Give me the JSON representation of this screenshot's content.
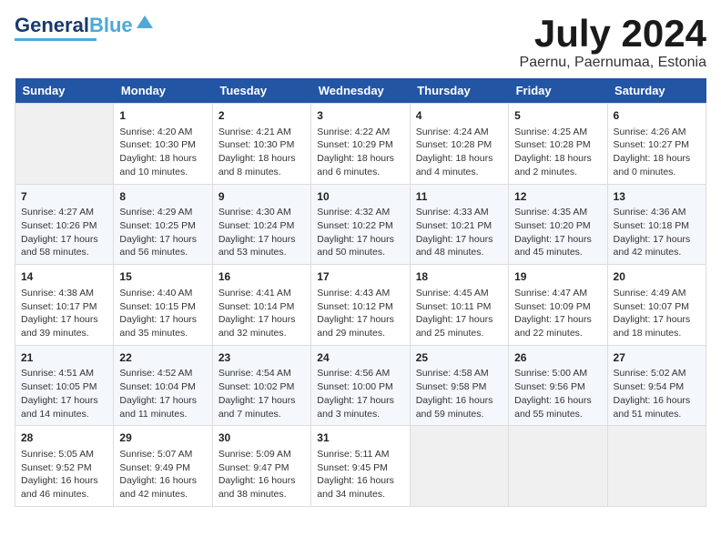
{
  "header": {
    "logo_general": "General",
    "logo_blue": "Blue",
    "month_title": "July 2024",
    "location": "Paernu, Paernumaa, Estonia"
  },
  "days_of_week": [
    "Sunday",
    "Monday",
    "Tuesday",
    "Wednesday",
    "Thursday",
    "Friday",
    "Saturday"
  ],
  "weeks": [
    [
      {
        "day": "",
        "info": ""
      },
      {
        "day": "1",
        "info": "Sunrise: 4:20 AM\nSunset: 10:30 PM\nDaylight: 18 hours\nand 10 minutes."
      },
      {
        "day": "2",
        "info": "Sunrise: 4:21 AM\nSunset: 10:30 PM\nDaylight: 18 hours\nand 8 minutes."
      },
      {
        "day": "3",
        "info": "Sunrise: 4:22 AM\nSunset: 10:29 PM\nDaylight: 18 hours\nand 6 minutes."
      },
      {
        "day": "4",
        "info": "Sunrise: 4:24 AM\nSunset: 10:28 PM\nDaylight: 18 hours\nand 4 minutes."
      },
      {
        "day": "5",
        "info": "Sunrise: 4:25 AM\nSunset: 10:28 PM\nDaylight: 18 hours\nand 2 minutes."
      },
      {
        "day": "6",
        "info": "Sunrise: 4:26 AM\nSunset: 10:27 PM\nDaylight: 18 hours\nand 0 minutes."
      }
    ],
    [
      {
        "day": "7",
        "info": "Sunrise: 4:27 AM\nSunset: 10:26 PM\nDaylight: 17 hours\nand 58 minutes."
      },
      {
        "day": "8",
        "info": "Sunrise: 4:29 AM\nSunset: 10:25 PM\nDaylight: 17 hours\nand 56 minutes."
      },
      {
        "day": "9",
        "info": "Sunrise: 4:30 AM\nSunset: 10:24 PM\nDaylight: 17 hours\nand 53 minutes."
      },
      {
        "day": "10",
        "info": "Sunrise: 4:32 AM\nSunset: 10:22 PM\nDaylight: 17 hours\nand 50 minutes."
      },
      {
        "day": "11",
        "info": "Sunrise: 4:33 AM\nSunset: 10:21 PM\nDaylight: 17 hours\nand 48 minutes."
      },
      {
        "day": "12",
        "info": "Sunrise: 4:35 AM\nSunset: 10:20 PM\nDaylight: 17 hours\nand 45 minutes."
      },
      {
        "day": "13",
        "info": "Sunrise: 4:36 AM\nSunset: 10:18 PM\nDaylight: 17 hours\nand 42 minutes."
      }
    ],
    [
      {
        "day": "14",
        "info": "Sunrise: 4:38 AM\nSunset: 10:17 PM\nDaylight: 17 hours\nand 39 minutes."
      },
      {
        "day": "15",
        "info": "Sunrise: 4:40 AM\nSunset: 10:15 PM\nDaylight: 17 hours\nand 35 minutes."
      },
      {
        "day": "16",
        "info": "Sunrise: 4:41 AM\nSunset: 10:14 PM\nDaylight: 17 hours\nand 32 minutes."
      },
      {
        "day": "17",
        "info": "Sunrise: 4:43 AM\nSunset: 10:12 PM\nDaylight: 17 hours\nand 29 minutes."
      },
      {
        "day": "18",
        "info": "Sunrise: 4:45 AM\nSunset: 10:11 PM\nDaylight: 17 hours\nand 25 minutes."
      },
      {
        "day": "19",
        "info": "Sunrise: 4:47 AM\nSunset: 10:09 PM\nDaylight: 17 hours\nand 22 minutes."
      },
      {
        "day": "20",
        "info": "Sunrise: 4:49 AM\nSunset: 10:07 PM\nDaylight: 17 hours\nand 18 minutes."
      }
    ],
    [
      {
        "day": "21",
        "info": "Sunrise: 4:51 AM\nSunset: 10:05 PM\nDaylight: 17 hours\nand 14 minutes."
      },
      {
        "day": "22",
        "info": "Sunrise: 4:52 AM\nSunset: 10:04 PM\nDaylight: 17 hours\nand 11 minutes."
      },
      {
        "day": "23",
        "info": "Sunrise: 4:54 AM\nSunset: 10:02 PM\nDaylight: 17 hours\nand 7 minutes."
      },
      {
        "day": "24",
        "info": "Sunrise: 4:56 AM\nSunset: 10:00 PM\nDaylight: 17 hours\nand 3 minutes."
      },
      {
        "day": "25",
        "info": "Sunrise: 4:58 AM\nSunset: 9:58 PM\nDaylight: 16 hours\nand 59 minutes."
      },
      {
        "day": "26",
        "info": "Sunrise: 5:00 AM\nSunset: 9:56 PM\nDaylight: 16 hours\nand 55 minutes."
      },
      {
        "day": "27",
        "info": "Sunrise: 5:02 AM\nSunset: 9:54 PM\nDaylight: 16 hours\nand 51 minutes."
      }
    ],
    [
      {
        "day": "28",
        "info": "Sunrise: 5:05 AM\nSunset: 9:52 PM\nDaylight: 16 hours\nand 46 minutes."
      },
      {
        "day": "29",
        "info": "Sunrise: 5:07 AM\nSunset: 9:49 PM\nDaylight: 16 hours\nand 42 minutes."
      },
      {
        "day": "30",
        "info": "Sunrise: 5:09 AM\nSunset: 9:47 PM\nDaylight: 16 hours\nand 38 minutes."
      },
      {
        "day": "31",
        "info": "Sunrise: 5:11 AM\nSunset: 9:45 PM\nDaylight: 16 hours\nand 34 minutes."
      },
      {
        "day": "",
        "info": ""
      },
      {
        "day": "",
        "info": ""
      },
      {
        "day": "",
        "info": ""
      }
    ]
  ]
}
